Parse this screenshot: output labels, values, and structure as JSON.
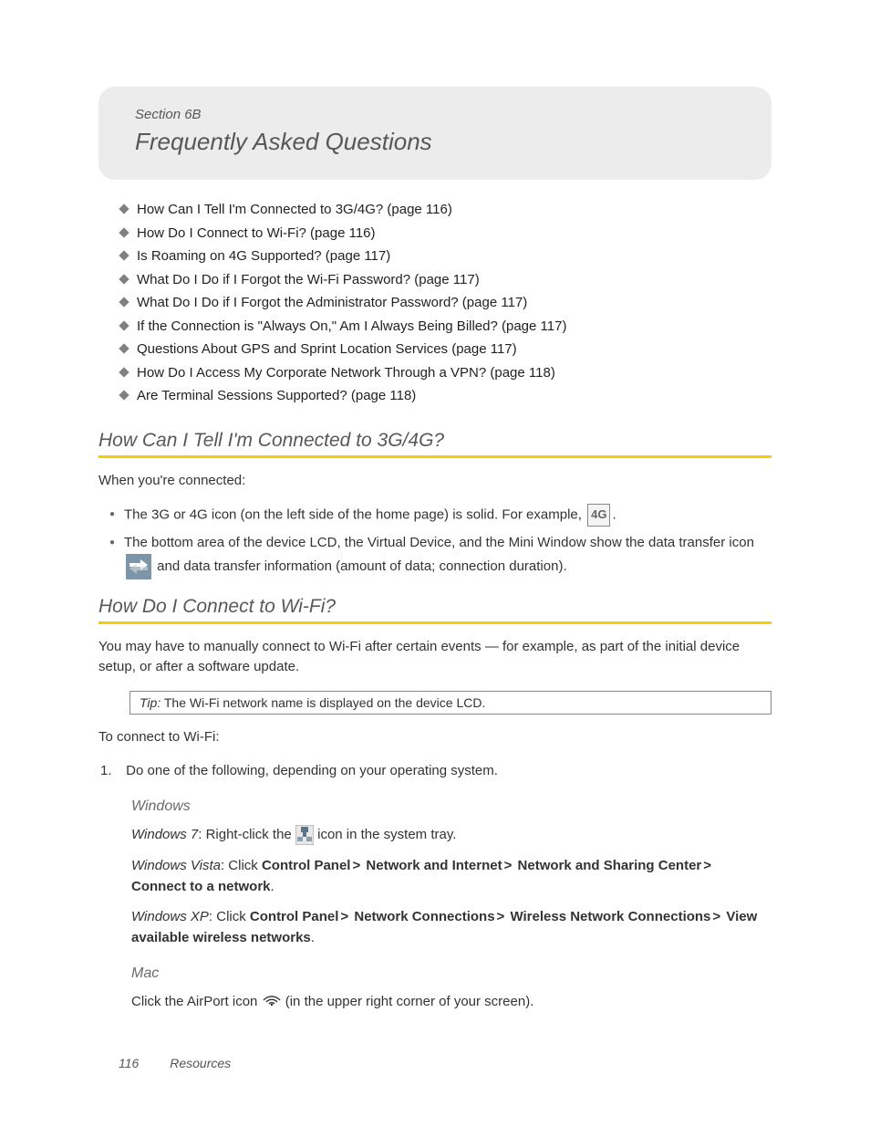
{
  "header": {
    "section_label": "Section 6B",
    "title": "Frequently Asked Questions"
  },
  "toc": [
    "How Can I Tell I'm Connected to 3G/4G? (page 116)",
    "How Do I Connect to Wi-Fi? (page 116)",
    "Is Roaming on 4G Supported? (page 117)",
    "What Do I Do if I Forgot the Wi-Fi Password? (page 117)",
    "What Do I Do if I Forgot the Administrator Password? (page 117)",
    "If the Connection is \"Always On,\" Am I Always Being Billed? (page 117)",
    "Questions About GPS and Sprint Location Services (page 117)",
    "How Do I Access My Corporate Network Through a VPN? (page 118)",
    "Are Terminal Sessions Supported? (page 118)"
  ],
  "section1": {
    "heading": "How Can I Tell I'm Connected to 3G/4G?",
    "intro": "When you're connected:",
    "bullet1_a": "The 3G or 4G icon (on the left side of the home page) is solid. For example, ",
    "bullet1_b": ".",
    "icon_4g_label": "4G",
    "bullet2_a": "The bottom area of the device LCD, the Virtual Device, and the Mini Window show the data transfer icon ",
    "bullet2_b": " and data transfer information (amount of data; connection duration)."
  },
  "section2": {
    "heading": "How Do I Connect to Wi-Fi?",
    "p1": "You may have to manually connect to Wi-Fi after certain events — for example, as part of the initial device setup, or after a software update.",
    "tip_label": "Tip:",
    "tip_text": " The Wi-Fi network name is displayed on the device LCD.",
    "p2": "To connect to Wi-Fi:",
    "step1_num": "1.",
    "step1_text": "Do one of the following, depending on your operating system.",
    "windows_heading": "Windows",
    "win7_os": "Windows 7",
    "win7_a": ": Right-click the ",
    "win7_b": " icon in the system tray.",
    "vista_os": "Windows Vista",
    "vista_prefix": ": Click ",
    "vista_parts": [
      "Control Panel",
      "Network and Internet",
      "Network and Sharing Center",
      "Connect to a network"
    ],
    "xp_os": "Windows XP",
    "xp_prefix": ": Click ",
    "xp_parts": [
      "Control Panel",
      "Network Connections",
      "Wireless Network Connections",
      "View available wireless networks"
    ],
    "mac_heading": "Mac",
    "mac_a": "Click the AirPort icon ",
    "mac_b": " (in the upper right corner of your screen)."
  },
  "footer": {
    "page_number": "116",
    "chapter": "Resources"
  }
}
